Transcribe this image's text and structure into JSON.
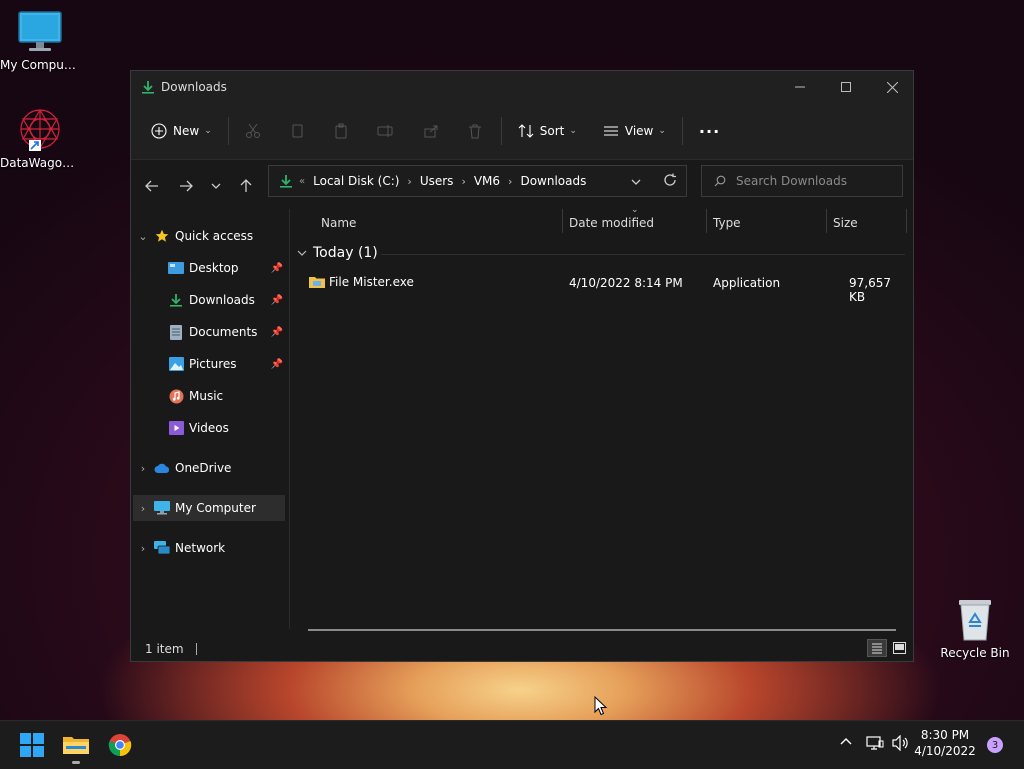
{
  "desktop": {
    "icons": [
      {
        "label": "My Computer"
      },
      {
        "label": "DataWagon..."
      },
      {
        "label": "Recycle Bin"
      }
    ]
  },
  "window": {
    "title": "Downloads",
    "toolbar": {
      "new_label": "New",
      "sort_label": "Sort",
      "view_label": "View",
      "more_label": "···"
    },
    "address": {
      "crumbs": [
        "Local Disk (C:)",
        "Users",
        "VM6",
        "Downloads"
      ]
    },
    "search": {
      "placeholder": "Search Downloads"
    },
    "nav": {
      "quick_access": "Quick access",
      "items": [
        {
          "label": "Desktop"
        },
        {
          "label": "Downloads"
        },
        {
          "label": "Documents"
        },
        {
          "label": "Pictures"
        },
        {
          "label": "Music"
        },
        {
          "label": "Videos"
        }
      ],
      "onedrive": "OneDrive",
      "my_computer": "My Computer",
      "network": "Network"
    },
    "columns": {
      "name": "Name",
      "date": "Date modified",
      "type": "Type",
      "size": "Size"
    },
    "group": {
      "label": "Today (1)"
    },
    "files": [
      {
        "name": "File Mister.exe",
        "date": "4/10/2022 8:14 PM",
        "type": "Application",
        "size": "97,657 KB"
      }
    ],
    "status": {
      "count": "1 item"
    }
  },
  "taskbar": {
    "time": "8:30 PM",
    "date": "4/10/2022",
    "notifications": "3"
  },
  "colors": {
    "accent_green": "#2fb36b",
    "folder_yellow": "#f0c24b",
    "window_bg": "#191919"
  }
}
